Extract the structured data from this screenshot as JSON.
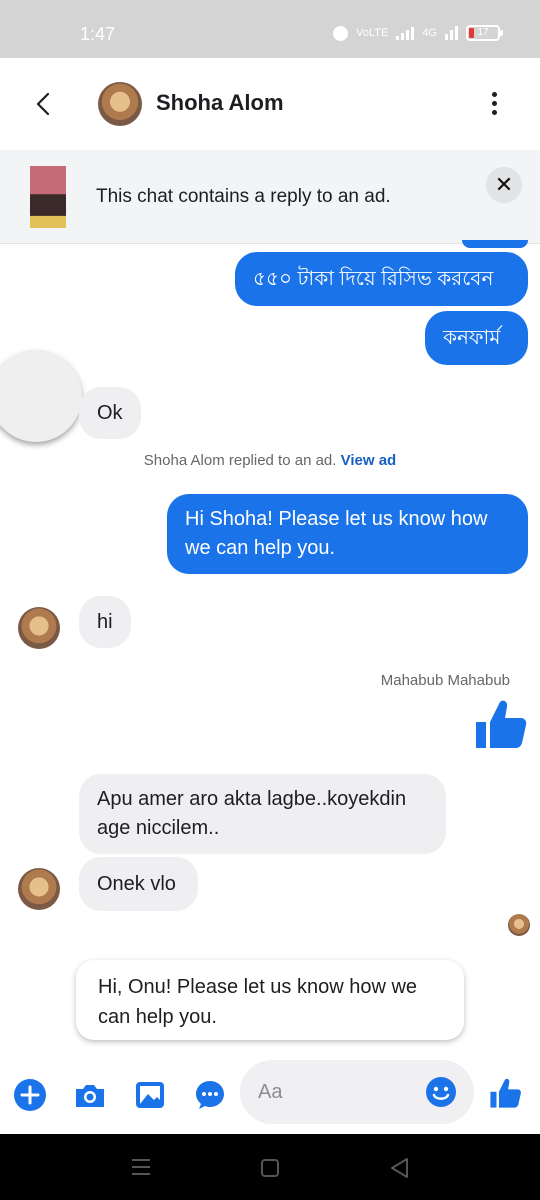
{
  "status_bar": {
    "time": "1:47",
    "battery": "17",
    "network": "4G",
    "volte": "VoLTE"
  },
  "header": {
    "back_label": "back",
    "contact_name": "Shoha Alom"
  },
  "ad_banner": {
    "text": "This chat contains a reply to an ad.",
    "close_label": "✕"
  },
  "messages": {
    "out_1": "৫৫০ টাকা দিয়ে রিসিভ করবেন",
    "out_2": "কনফার্ম",
    "in_ok": "Ok",
    "system_text": "Shoha Alom replied to an ad.",
    "system_link": "View ad",
    "out_greeting": "Hi Shoha! Please let us know how we can help you.",
    "in_hi": "hi",
    "sender_label": "Mahabub Mahabub",
    "in_long": "Apu amer aro akta lagbe..koyekdin age niccilem..",
    "in_vlo": "Onek vlo",
    "suggested_reply": "Hi, Onu! Please let us know how we can help you."
  },
  "composer": {
    "placeholder": "Aa"
  },
  "colors": {
    "accent": "#1a73e8",
    "incoming_bubble": "#efeff1"
  },
  "icons": [
    "back-arrow-icon",
    "more-options-icon",
    "close-icon",
    "plus-icon",
    "camera-icon",
    "gallery-icon",
    "chat-more-icon",
    "emoji-icon",
    "like-icon",
    "thumbs-up-icon",
    "menu-nav-icon",
    "home-nav-icon",
    "back-nav-icon"
  ]
}
